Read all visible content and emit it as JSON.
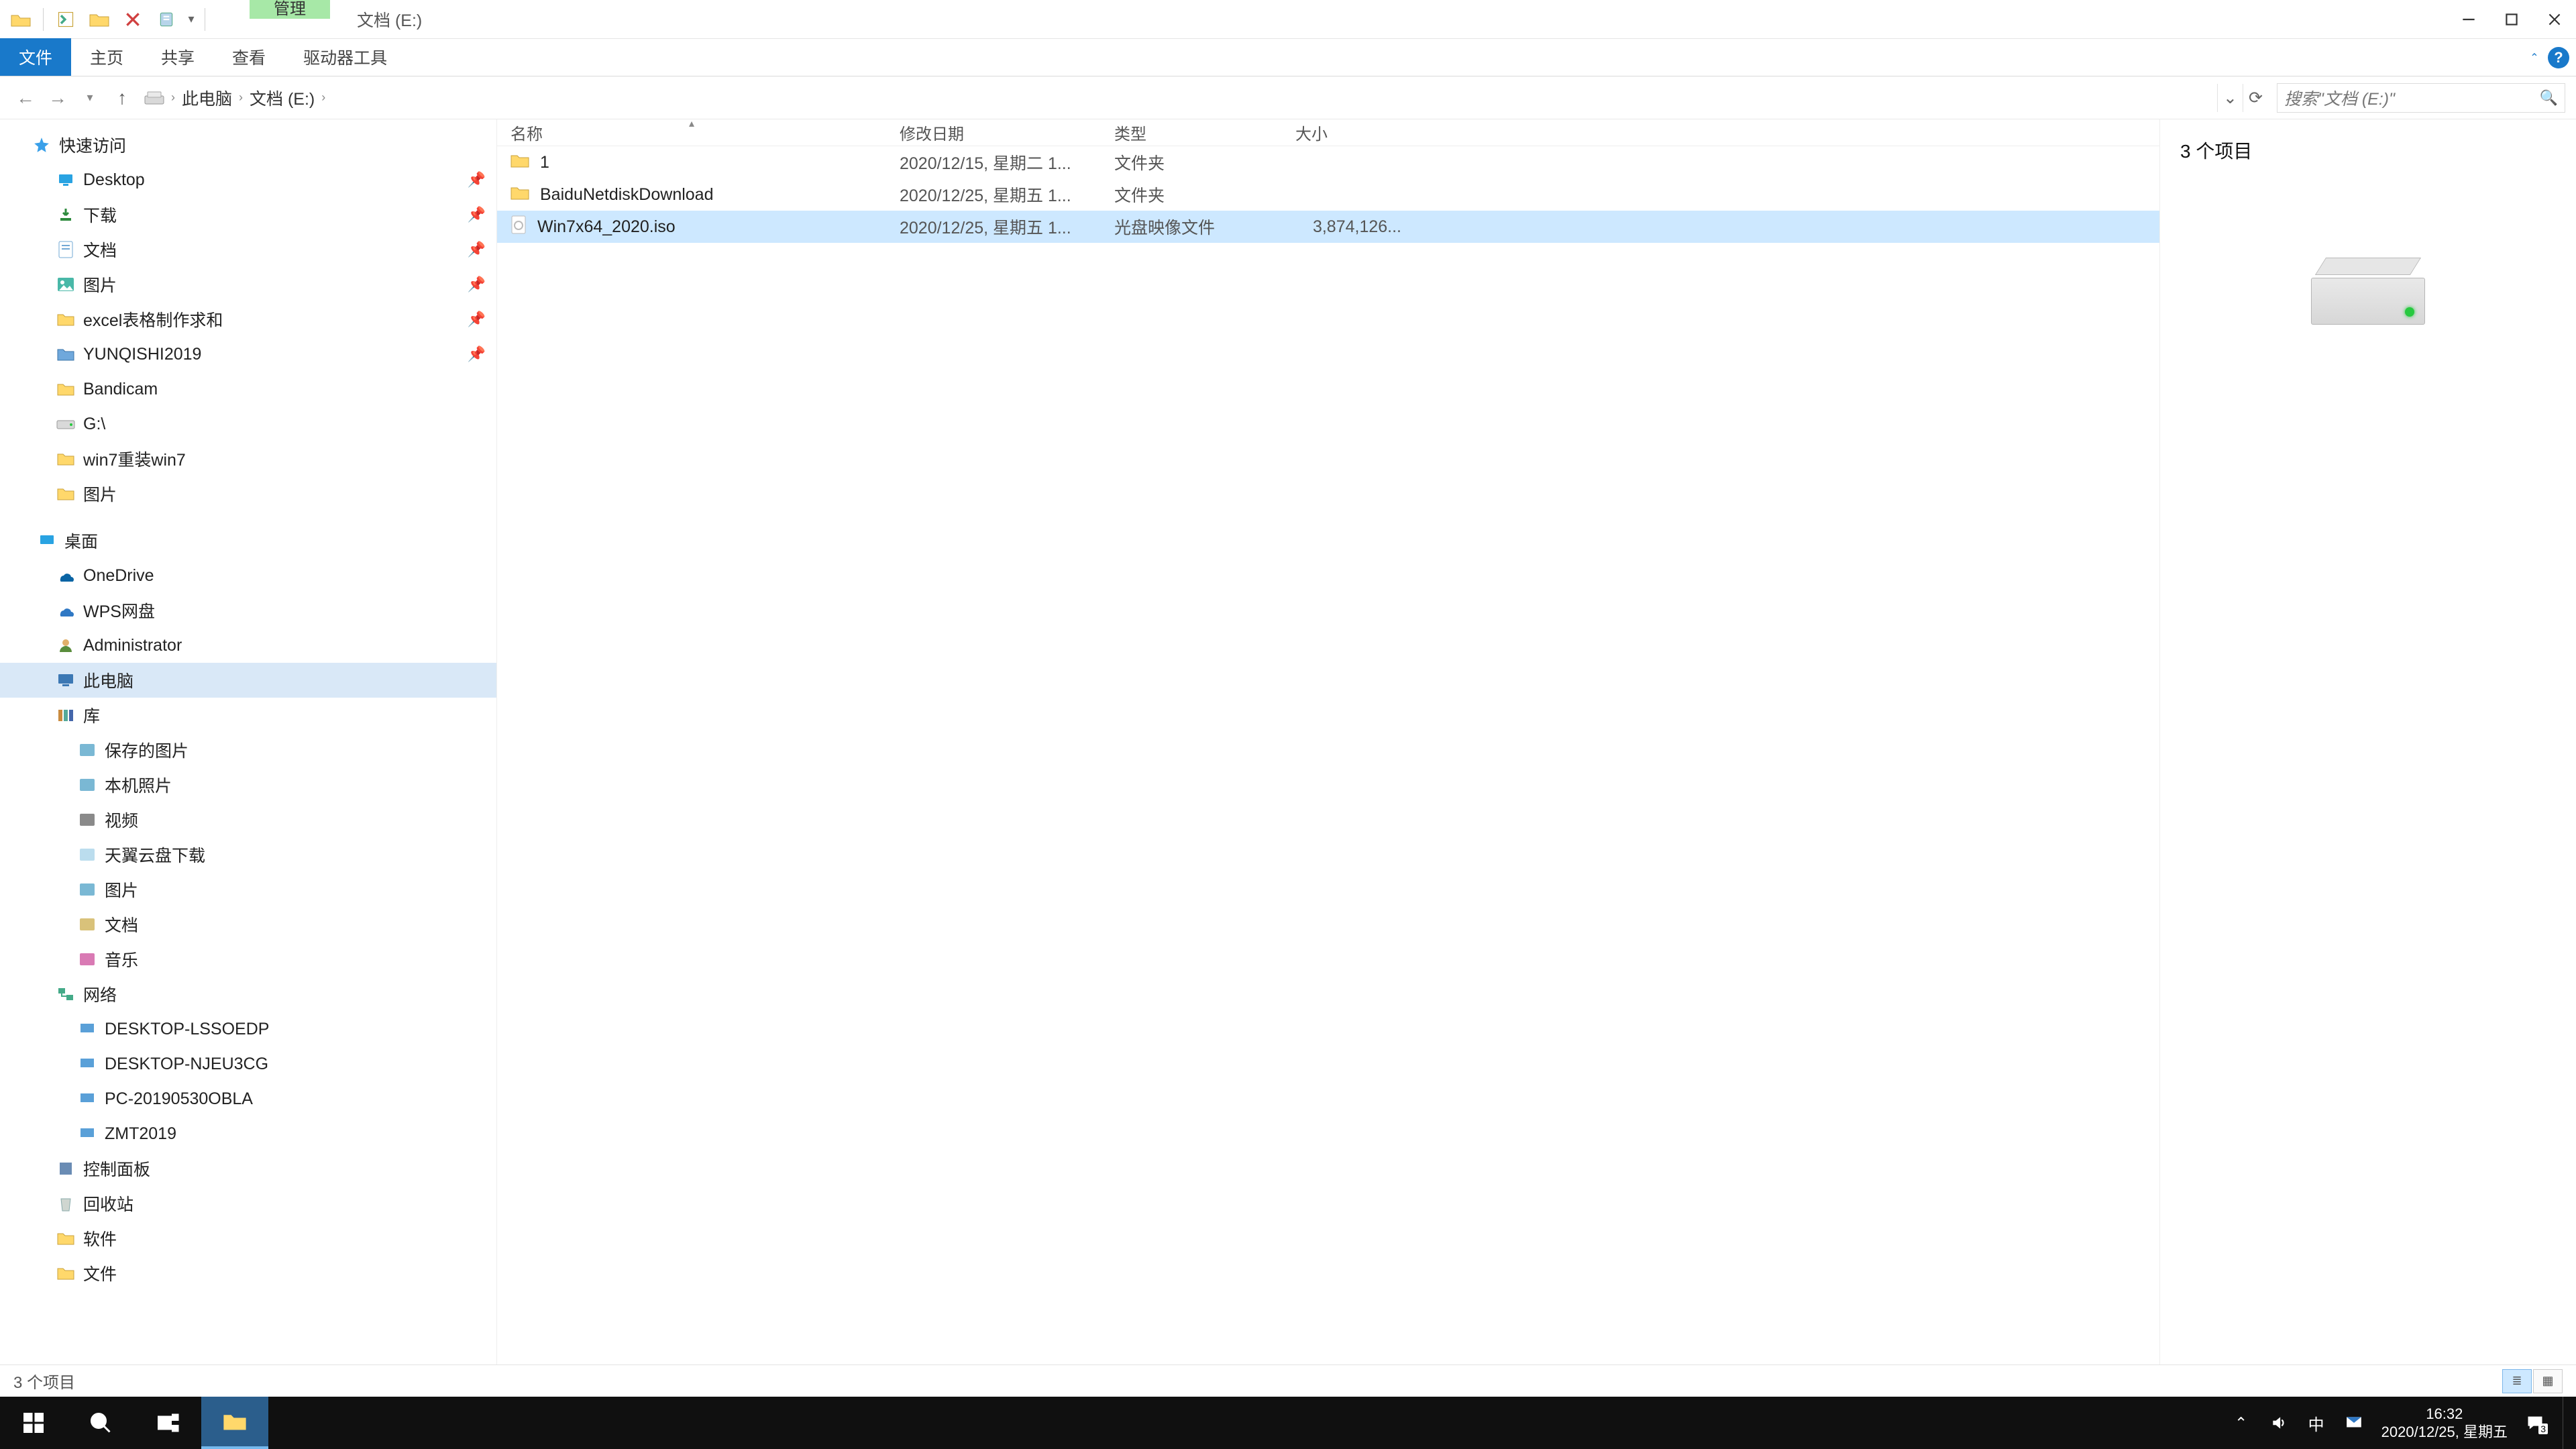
{
  "title": {
    "context_tab": "管理",
    "window_title": "文档 (E:)"
  },
  "ribbon": {
    "tabs": [
      "文件",
      "主页",
      "共享",
      "查看",
      "驱动器工具"
    ]
  },
  "address": {
    "segments": [
      "此电脑",
      "文档 (E:)"
    ],
    "search_placeholder": "搜索\"文档 (E:)\""
  },
  "nav_tree": {
    "quick_access": "快速访问",
    "qa_items": [
      {
        "label": "Desktop",
        "icon": "desktop"
      },
      {
        "label": "下载",
        "icon": "downloads"
      },
      {
        "label": "文档",
        "icon": "documents"
      },
      {
        "label": "图片",
        "icon": "pictures"
      },
      {
        "label": "excel表格制作求和",
        "icon": "folder"
      },
      {
        "label": "YUNQISHI2019",
        "icon": "folder-blue"
      },
      {
        "label": "Bandicam",
        "icon": "folder"
      },
      {
        "label": "G:\\",
        "icon": "drive"
      },
      {
        "label": "win7重装win7",
        "icon": "folder"
      },
      {
        "label": "图片",
        "icon": "folder"
      }
    ],
    "desktop": "桌面",
    "cloud": [
      {
        "label": "OneDrive",
        "icon": "onedrive"
      },
      {
        "label": "WPS网盘",
        "icon": "wps"
      }
    ],
    "user": "Administrator",
    "thispc": "此电脑",
    "libraries": "库",
    "lib_items": [
      "保存的图片",
      "本机照片",
      "视频",
      "天翼云盘下载",
      "图片",
      "文档",
      "音乐"
    ],
    "network": "网络",
    "net_items": [
      "DESKTOP-LSSOEDP",
      "DESKTOP-NJEU3CG",
      "PC-20190530OBLA",
      "ZMT2019"
    ],
    "control_panel": "控制面板",
    "recycle": "回收站",
    "soft": "软件",
    "docs": "文件"
  },
  "columns": {
    "name": "名称",
    "date": "修改日期",
    "type": "类型",
    "size": "大小"
  },
  "files": [
    {
      "name": "1",
      "date": "2020/12/15, 星期二 1...",
      "type": "文件夹",
      "size": "",
      "icon": "folder",
      "selected": false
    },
    {
      "name": "BaiduNetdiskDownload",
      "date": "2020/12/25, 星期五 1...",
      "type": "文件夹",
      "size": "",
      "icon": "folder",
      "selected": false
    },
    {
      "name": "Win7x64_2020.iso",
      "date": "2020/12/25, 星期五 1...",
      "type": "光盘映像文件",
      "size": "3,874,126...",
      "icon": "iso",
      "selected": true
    }
  ],
  "preview": {
    "header": "3 个项目"
  },
  "status": {
    "text": "3 个项目"
  },
  "taskbar": {
    "time": "16:32",
    "date": "2020/12/25, 星期五",
    "ime": "中",
    "notif_count": "3"
  }
}
